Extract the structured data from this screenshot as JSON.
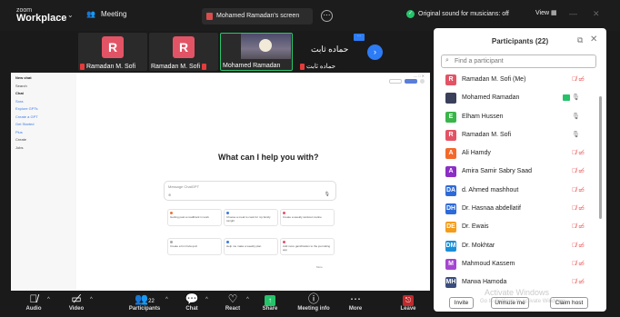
{
  "topbar": {
    "logo_top": "zoom",
    "logo_bottom": "Workplace",
    "meeting_label": "Meeting",
    "share_tab": "Mohamed Ramadan's screen",
    "original_sound": "Original sound for musicians: off",
    "view_label": "View"
  },
  "thumbnails": [
    {
      "initial": "R",
      "name": "Ramadan M. Sofi"
    },
    {
      "initial": "R",
      "name": "Ramadan M. Sofi"
    },
    {
      "name": "Mohamed Ramadan"
    },
    {
      "text": "حماده ثابت",
      "name": "حماده ثابت"
    }
  ],
  "shared_screen": {
    "sidebar": [
      "New chat",
      "Search",
      "Chat",
      "Sora",
      "Explore GPTs",
      "Create a GPT",
      "Get Started",
      "Plus",
      "Create",
      "Jobs"
    ],
    "heading": "What can I help you with?",
    "input_placeholder": "Message ChatGPT",
    "cards": [
      "Getting past a roadblock in work",
      "Choose a meal to cook for my family tonight",
      "Create a weekly workout routine",
      "Create a fun trivia quiz",
      "Help me make a weekly plan",
      "Add more gamification to the journaling app"
    ],
    "more_link": "More"
  },
  "participants": {
    "title": "Participants (22)",
    "search_placeholder": "Find a participant",
    "list": [
      {
        "initial": "R",
        "name": "Ramadan M. Sofi (Me)",
        "color": "#e25465"
      },
      {
        "initial": "",
        "name": "Mohamed Ramadan",
        "color": "#3a3f5a"
      },
      {
        "initial": "E",
        "name": "Elham Hussen",
        "color": "#3bb44a"
      },
      {
        "initial": "R",
        "name": "Ramadan M. Sofi",
        "color": "#e25465"
      },
      {
        "initial": "A",
        "name": "Ali Hamdy",
        "color": "#f26a2b"
      },
      {
        "initial": "A",
        "name": "Amira Samir Sabry Saad",
        "color": "#8b2fc4"
      },
      {
        "initial": "DA",
        "name": "d. Ahmed mashhout",
        "color": "#2d6ad8"
      },
      {
        "initial": "DH",
        "name": "Dr. Hasnaa abdellatif",
        "color": "#2d6ad8"
      },
      {
        "initial": "DE",
        "name": "Dr. Ewais",
        "color": "#f59c1a"
      },
      {
        "initial": "DM",
        "name": "Dr. Mokhtar",
        "color": "#1a8fd8"
      },
      {
        "initial": "M",
        "name": "Mahmoud Kassem",
        "color": "#a546d1"
      },
      {
        "initial": "MH",
        "name": "Marwa Hamoda",
        "color": "#3a4e7e"
      }
    ],
    "buttons": {
      "invite": "Invite",
      "unmute_me": "Unmute me",
      "claim_host": "Claim host"
    }
  },
  "watermark": {
    "line1": "Activate Windows",
    "line2": "Go to Settings to activate Windows."
  },
  "toolbar": {
    "audio": "Audio",
    "video": "Video",
    "participants": "Participants",
    "participant_count": "22",
    "chat": "Chat",
    "react": "React",
    "share": "Share",
    "meeting_info": "Meeting info",
    "more": "More",
    "leave": "Leave"
  }
}
